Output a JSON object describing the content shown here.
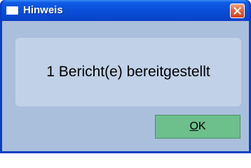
{
  "window": {
    "title": "Hinweis",
    "close_icon": "close-icon"
  },
  "message": {
    "text": "1 Bericht(e) bereitgestellt"
  },
  "ok_button": {
    "mnemonic": "O",
    "rest": "K"
  },
  "colors": {
    "titlebar": "#0a4fd8",
    "close_button": "#e3633a",
    "client_background": "#aabfdc",
    "message_panel": "#c1d1e8",
    "ok_button": "#6dbf8c"
  }
}
